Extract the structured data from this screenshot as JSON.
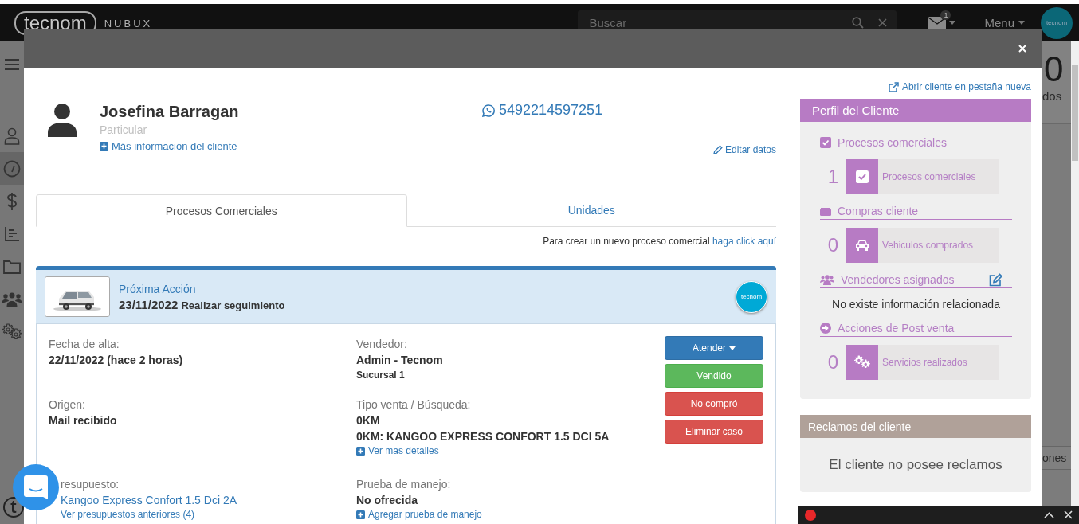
{
  "topbar": {
    "logo": "tecnom",
    "product": "NUBUX",
    "search": {
      "placeholder": "Buscar"
    },
    "mail_badge": "1",
    "menu": "Menu",
    "avatar_text": "tecnom"
  },
  "sidebar": {
    "items": [
      {
        "kind": "menu",
        "selected": false
      },
      {
        "kind": "user",
        "selected": false
      },
      {
        "kind": "gauge",
        "selected": true
      },
      {
        "kind": "dollar",
        "selected": false
      },
      {
        "kind": "chart",
        "selected": false
      },
      {
        "kind": "folder",
        "selected": false
      },
      {
        "kind": "users",
        "selected": false
      },
      {
        "kind": "gears",
        "selected": false
      }
    ],
    "footer_logo": "t"
  },
  "background": {
    "counter": "0",
    "counter_label": "dos",
    "tab_fragment": "ones"
  },
  "modal": {
    "client": {
      "name": "Josefina Barragan",
      "type": "Particular",
      "more_info": "Más información del cliente",
      "phone": "5492214597251",
      "edit": "Editar datos"
    },
    "tabs": [
      {
        "label": "Procesos Comerciales",
        "selected": true
      },
      {
        "label": "Unidades",
        "selected": false
      }
    ],
    "create_hint": {
      "text": "Para crear un nuevo proceso comercial",
      "link": "haga click aquí"
    },
    "process": {
      "next_action_label": "Próxima Acción",
      "next_action_date": "23/11/2022",
      "next_action_text": "Realizar seguimiento",
      "badge": "tecnom",
      "rows": [
        {
          "cells": [
            {
              "label": "Fecha de alta:",
              "lines": [
                {
                  "kind": "value",
                  "text": "22/11/2022 (hace 2 horas)"
                }
              ]
            },
            {
              "label": "Vendedor:",
              "lines": [
                {
                  "kind": "value",
                  "text": "Admin - Tecnom"
                },
                {
                  "kind": "sub",
                  "text": "Sucursal 1"
                }
              ]
            }
          ]
        },
        {
          "cells": [
            {
              "label": "Origen:",
              "lines": [
                {
                  "kind": "value",
                  "text": "Mail recibido"
                }
              ]
            },
            {
              "label": "Tipo venta / Búsqueda:",
              "lines": [
                {
                  "kind": "value",
                  "text": "0KM"
                },
                {
                  "kind": "value",
                  "text": "0KM: KANGOO EXPRESS CONFORT 1.5 DCI 5A"
                },
                {
                  "kind": "plus_link",
                  "text": "Ver mas detalles"
                }
              ]
            }
          ]
        },
        {
          "cells": [
            {
              "label": "resupuesto:",
              "lines": [
                {
                  "kind": "link",
                  "text": "Kangoo Express Confort 1.5 Dci 2A"
                },
                {
                  "kind": "small_link",
                  "text": "Ver presupuestos anteriores (4)"
                }
              ]
            },
            {
              "label": "Prueba de manejo:",
              "lines": [
                {
                  "kind": "value",
                  "text": "No ofrecida"
                },
                {
                  "kind": "plus_link",
                  "text": "Agregar prueba de manejo"
                }
              ]
            }
          ]
        }
      ],
      "buttons": [
        {
          "label": "Atender",
          "kind": "primary",
          "dropdown": true
        },
        {
          "label": "Vendido",
          "kind": "success",
          "dropdown": false
        },
        {
          "label": "No compró",
          "kind": "danger",
          "dropdown": false
        },
        {
          "label": "Eliminar caso",
          "kind": "danger",
          "dropdown": false
        }
      ]
    },
    "open_link": "Abrir cliente en pestaña nueva",
    "profile": {
      "title": "Perfil del Cliente",
      "sections": [
        {
          "kind": "stat",
          "title": "Procesos comerciales",
          "count": "1",
          "tile_label": "Procesos comerciales"
        },
        {
          "kind": "stat",
          "title": "Compras cliente",
          "count": "0",
          "tile_label": "Vehiculos comprados"
        },
        {
          "kind": "text",
          "title": "Vendedores asignados",
          "text": "No existe información relacionada"
        },
        {
          "kind": "stat",
          "title": "Acciones de Post venta",
          "count": "0",
          "tile_label": "Servicios realizados"
        }
      ]
    },
    "complaints": {
      "title": "Reclamos del cliente",
      "text": "El cliente no posee reclamos"
    }
  }
}
